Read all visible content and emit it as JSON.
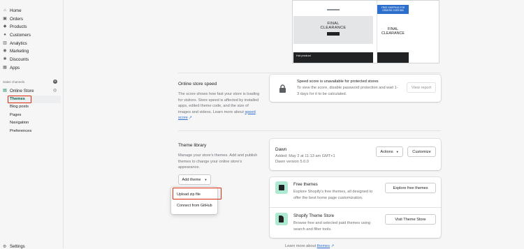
{
  "sidebar": {
    "items": [
      {
        "label": "Home",
        "icon": "home-icon"
      },
      {
        "label": "Orders",
        "icon": "orders-icon"
      },
      {
        "label": "Products",
        "icon": "tag-icon"
      },
      {
        "label": "Customers",
        "icon": "customer-icon"
      },
      {
        "label": "Analytics",
        "icon": "analytics-icon"
      },
      {
        "label": "Marketing",
        "icon": "marketing-icon"
      },
      {
        "label": "Discounts",
        "icon": "discount-icon"
      },
      {
        "label": "Apps",
        "icon": "apps-icon"
      }
    ],
    "sales_channels_label": "Sales channels",
    "online_store_label": "Online Store",
    "sub_items": [
      "Themes",
      "Blog posts",
      "Pages",
      "Navigation",
      "Preferences"
    ],
    "settings_label": "Settings"
  },
  "preview": {
    "left_title_line1": "FINAL",
    "left_title_line2": "CLEARANCE",
    "right_banner": "FREE SHIPPING FOR ORDERS OVER $50",
    "right_title_line1": "FINAL",
    "right_title_line2": "CLEARANCE",
    "left_footer": "Hot product"
  },
  "speed": {
    "heading": "Online store speed",
    "description": "The score shows how fast your store is loading for visitors. Store speed is affected by installed apps, edited theme code, and the size of images and videos. Learn more about",
    "link": "speed score",
    "card_title": "Speed score is unavailable for protected stores",
    "card_text": "To view the score, disable password protection and wait 1-3 days for it to be calculated.",
    "view_report": "View report"
  },
  "library": {
    "heading": "Theme library",
    "description": "Manage your store's themes. Add and publish themes to change your online store's appearance.",
    "add_theme": "Add theme",
    "theme_name": "Dawn",
    "theme_added": "Added: May 2 at 11:13 am GMT+1",
    "theme_version": "Dawn version 5.0.0",
    "actions": "Actions",
    "customize": "Customize",
    "dropdown": [
      "Upload zip file",
      "Connect from GitHub"
    ],
    "free_title": "Free themes",
    "free_text": "Explore Shopify's free themes, all designed to offer the best home page customization.",
    "free_button": "Explore free themes",
    "store_title": "Shopify Theme Store",
    "store_text": "Browse free and selected paid themes using search and filter tools.",
    "store_button": "Visit Theme Store",
    "footer_prefix": "Learn more about",
    "footer_link": "themes"
  }
}
